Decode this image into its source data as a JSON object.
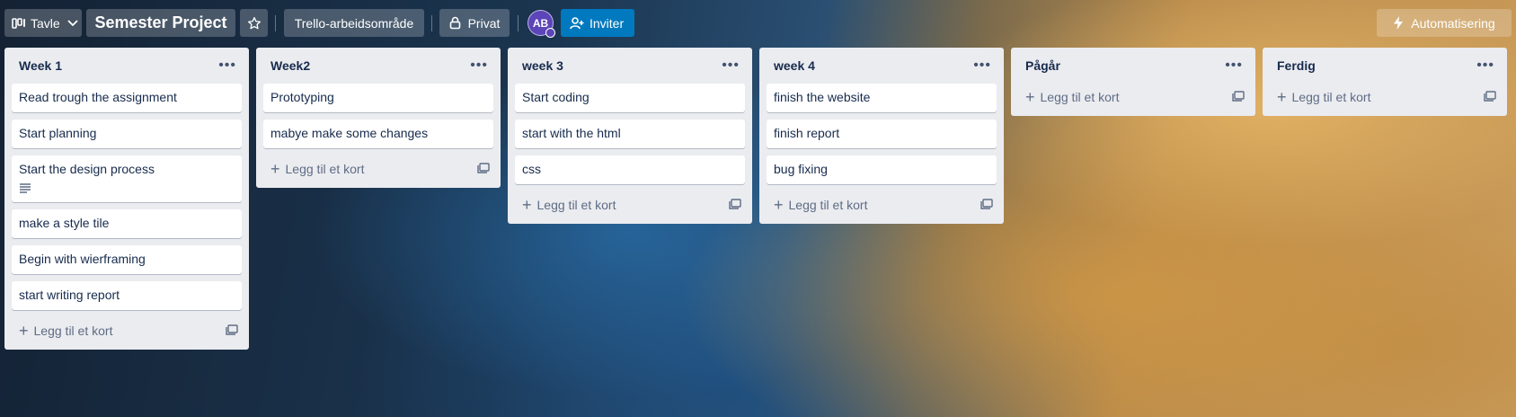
{
  "header": {
    "board_switch_label": "Tavle",
    "board_title": "Semester Project",
    "workspace_label": "Trello-arbeidsområde",
    "visibility_label": "Privat",
    "avatar_initials": "AB",
    "invite_label": "Inviter",
    "automation_label": "Automatisering"
  },
  "add_card_label": "Legg til et kort",
  "lists": [
    {
      "title": "Week 1",
      "cards": [
        {
          "text": "Read trough the assignment"
        },
        {
          "text": "Start planning"
        },
        {
          "text": "Start the design process",
          "has_description": true
        },
        {
          "text": "make a style tile"
        },
        {
          "text": "Begin with wierframing"
        },
        {
          "text": "start writing report"
        }
      ]
    },
    {
      "title": "Week2",
      "cards": [
        {
          "text": "Prototyping"
        },
        {
          "text": "mabye make some changes"
        }
      ]
    },
    {
      "title": "week 3",
      "cards": [
        {
          "text": "Start coding"
        },
        {
          "text": "start with the html"
        },
        {
          "text": "css"
        }
      ]
    },
    {
      "title": "week 4",
      "cards": [
        {
          "text": "finish the website"
        },
        {
          "text": "finish report"
        },
        {
          "text": "bug fixing"
        }
      ]
    },
    {
      "title": "Pågår",
      "cards": []
    },
    {
      "title": "Ferdig",
      "cards": []
    }
  ],
  "icons": {
    "board": "board-icon",
    "chevron": "chevron-down-icon",
    "star": "star-icon",
    "lock": "lock-icon",
    "invite": "add-person-icon",
    "automation": "lightning-icon",
    "list_menu": "more-icon",
    "add": "plus-icon",
    "template": "card-template-icon",
    "description": "description-icon"
  }
}
